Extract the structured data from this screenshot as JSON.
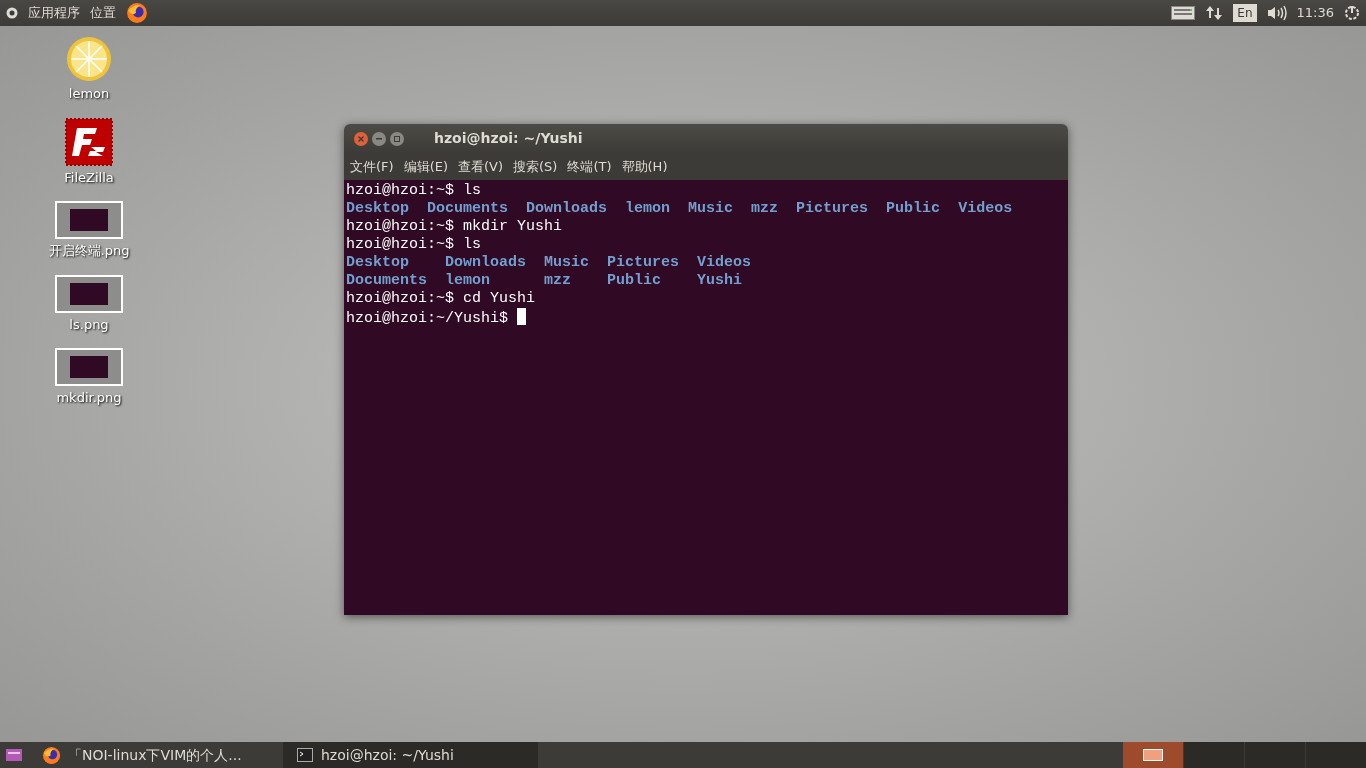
{
  "top_panel": {
    "menus": [
      "应用程序",
      "位置"
    ],
    "keyboard_layout": "En",
    "clock": "11:36"
  },
  "desktop_icons": [
    {
      "kind": "lemon",
      "label": "lemon"
    },
    {
      "kind": "filezilla",
      "label": "FileZilla"
    },
    {
      "kind": "image",
      "label": "开启终端.png"
    },
    {
      "kind": "image",
      "label": "ls.png"
    },
    {
      "kind": "image",
      "label": "mkdir.png"
    }
  ],
  "window": {
    "title": "hzoi@hzoi: ~/Yushi",
    "menu": [
      "文件(F)",
      "编辑(E)",
      "查看(V)",
      "搜索(S)",
      "终端(T)",
      "帮助(H)"
    ],
    "lines": [
      {
        "kind": "command",
        "text": "hzoi@hzoi:~$ ls"
      },
      {
        "kind": "listing",
        "rows": [
          [
            "Desktop",
            "Documents",
            "Downloads",
            "lemon",
            "Music",
            "mzz",
            "Pictures",
            "Public",
            "Videos"
          ]
        ]
      },
      {
        "kind": "command",
        "text": "hzoi@hzoi:~$ mkdir Yushi"
      },
      {
        "kind": "command",
        "text": "hzoi@hzoi:~$ ls"
      },
      {
        "kind": "listing",
        "rows": [
          [
            "Desktop",
            "Downloads",
            "Music",
            "Pictures",
            "Videos"
          ],
          [
            "Documents",
            "lemon",
            "mzz",
            "Public",
            "Yushi"
          ]
        ]
      },
      {
        "kind": "command",
        "text": "hzoi@hzoi:~$ cd Yushi"
      },
      {
        "kind": "prompt",
        "text": "hzoi@hzoi:~/Yushi$"
      }
    ]
  },
  "taskbar": {
    "tasks": [
      {
        "kind": "browser",
        "label": "「NOI-linux下VIM的个人...",
        "selected": false
      },
      {
        "kind": "terminal",
        "label": "hzoi@hzoi: ~/Yushi",
        "selected": true
      }
    ],
    "workspaces": [
      {
        "selected": true
      },
      {
        "selected": false
      },
      {
        "selected": false
      },
      {
        "selected": false
      }
    ]
  }
}
